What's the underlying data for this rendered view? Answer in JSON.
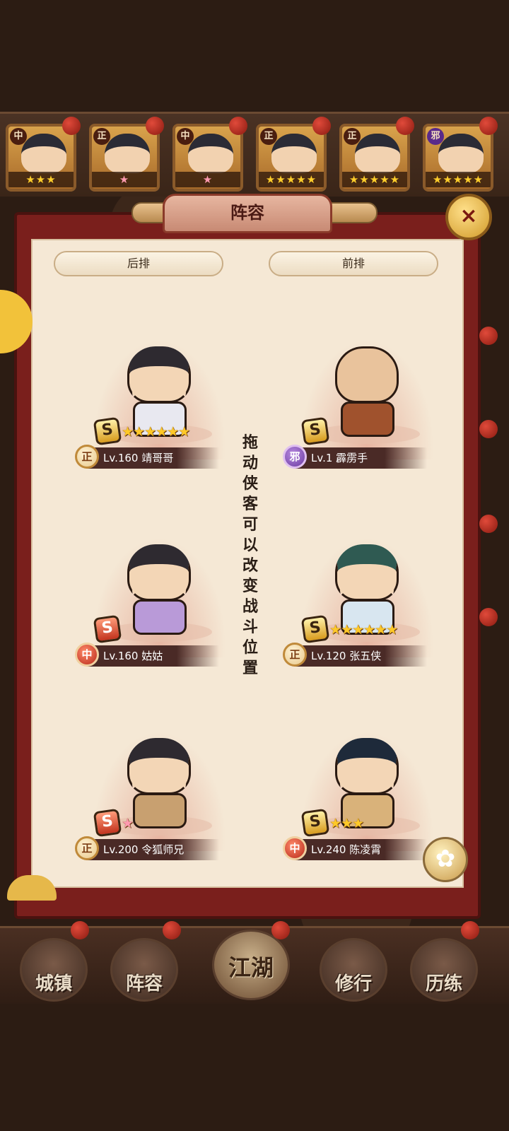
{
  "top_strip": {
    "cards": [
      {
        "faction": "中",
        "stars": "★★★"
      },
      {
        "faction": "正",
        "stars": "★"
      },
      {
        "faction": "中",
        "stars": "★"
      },
      {
        "faction": "正",
        "stars": "★★★★★"
      },
      {
        "faction": "正",
        "stars": "★★★★★"
      },
      {
        "faction": "邪",
        "stars": "★★★★★"
      }
    ]
  },
  "panel": {
    "title": "阵容",
    "back_row_label": "后排",
    "front_row_label": "前排",
    "hint": "拖动侠客可以改变战斗位置",
    "close_icon": "×",
    "heroes": [
      {
        "rank": "S",
        "stars": "★★★★★★",
        "faction": "正",
        "level_name": "Lv.160 靖哥哥"
      },
      {
        "rank": "S",
        "stars": "",
        "faction": "邪",
        "level_name": "Lv.1 霹雳手"
      },
      {
        "rank": "S",
        "stars": "",
        "faction": "中",
        "level_name": "Lv.160 姑姑"
      },
      {
        "rank": "S",
        "stars": "★★★★★★",
        "faction": "正",
        "level_name": "Lv.120 张五侠"
      },
      {
        "rank": "S",
        "stars": "★",
        "faction": "正",
        "level_name": "Lv.200 令狐师兄"
      },
      {
        "rank": "S",
        "stars": "★★★",
        "faction": "中",
        "level_name": "Lv.240 陈凌霄"
      }
    ]
  },
  "bottom_nav": [
    {
      "label": "城镇"
    },
    {
      "label": "阵容"
    },
    {
      "label": "江湖"
    },
    {
      "label": "修行"
    },
    {
      "label": "历练"
    }
  ]
}
